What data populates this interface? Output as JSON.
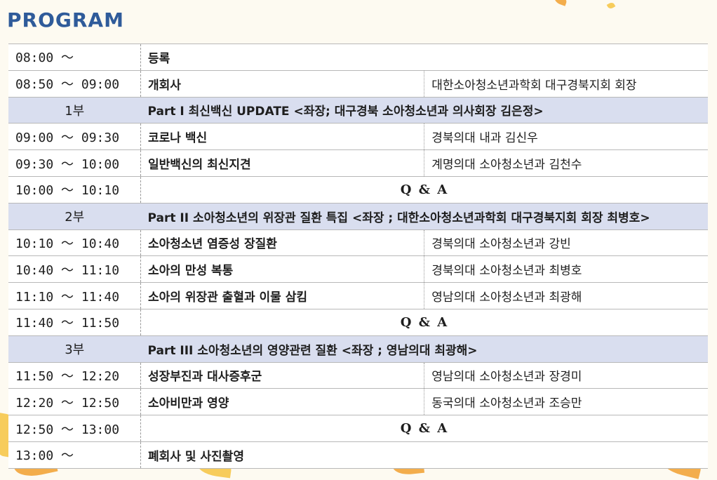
{
  "heading": "PROGRAM",
  "colors": {
    "heading": "#2f5b9a",
    "section_bg": "#d9deef",
    "leaf_orange": "#f2a43a",
    "leaf_yellow": "#f6c64a"
  },
  "rows": [
    {
      "kind": "item",
      "time": "08:00 ～",
      "topic": "등록",
      "speaker": ""
    },
    {
      "kind": "item",
      "time": "08:50 ～ 09:00",
      "topic": "개회사",
      "speaker": "대한소아청소년과학회 대구경북지회 회장"
    },
    {
      "kind": "section",
      "num": "1부",
      "title": "Part I 최신백신 UPDATE <좌장; 대구경북 소아청소년과 의사회장 김은정>"
    },
    {
      "kind": "item",
      "time": "09:00 ～ 09:30",
      "topic": "코로나 백신",
      "speaker": "경북의대 내과 김신우"
    },
    {
      "kind": "item",
      "time": "09:30 ～ 10:00",
      "topic": "일반백신의 최신지견",
      "speaker": "계명의대 소아청소년과 김천수"
    },
    {
      "kind": "qa",
      "time": "10:00 ～ 10:10",
      "label": "Q & A"
    },
    {
      "kind": "section",
      "num": "2부",
      "title": "Part II 소아청소년의 위장관 질환 특집 <좌장 ; 대한소아청소년과학회 대구경북지회 회장 최병호>"
    },
    {
      "kind": "item",
      "time": "10:10 ～ 10:40",
      "topic": "소아청소년 염증성 장질환",
      "speaker": "경북의대 소아청소년과 강빈"
    },
    {
      "kind": "item",
      "time": "10:40 ～ 11:10",
      "topic": "소아의 만성 복통",
      "speaker": "경북의대 소아청소년과 최병호"
    },
    {
      "kind": "item",
      "time": "11:10 ～ 11:40",
      "topic": "소아의 위장관 출혈과 이물 삼킴",
      "speaker": "영남의대 소아청소년과 최광해"
    },
    {
      "kind": "qa",
      "time": "11:40 ～ 11:50",
      "label": "Q & A"
    },
    {
      "kind": "section",
      "num": "3부",
      "title": "Part III 소아청소년의 영양관련 질환 <좌장 ; 영남의대 최광해>"
    },
    {
      "kind": "item",
      "time": "11:50 ～ 12:20",
      "topic": "성장부진과 대사증후군",
      "speaker": "영남의대 소아청소년과 장경미"
    },
    {
      "kind": "item",
      "time": "12:20 ～ 12:50",
      "topic": "소아비만과 영양",
      "speaker": "동국의대 소아청소년과 조승만"
    },
    {
      "kind": "qa",
      "time": "12:50 ～ 13:00",
      "label": "Q & A"
    },
    {
      "kind": "item",
      "time": "13:00 ～",
      "topic": "폐회사 및 사진촬영",
      "speaker": ""
    }
  ]
}
